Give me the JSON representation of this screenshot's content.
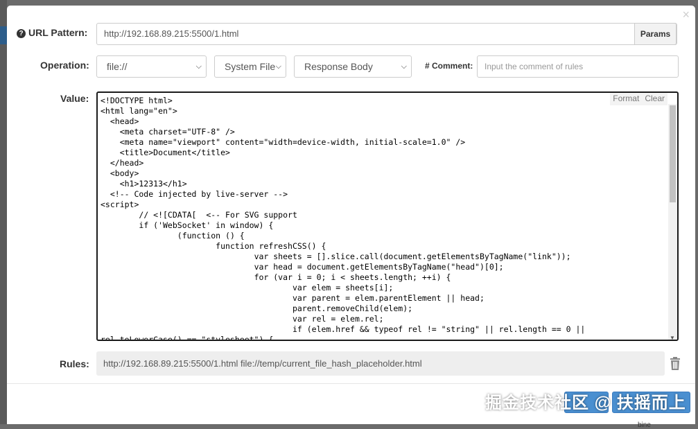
{
  "modal": {
    "close_label": "×",
    "url_pattern": {
      "label": "URL Pattern:",
      "value": "http://192.168.89.215:5500/1.html",
      "params_label": "Params"
    },
    "operation": {
      "label": "Operation:",
      "protocol": "file://",
      "source": "System File",
      "target": "Response Body"
    },
    "comment": {
      "label": "# Comment:",
      "placeholder": "Input the comment of rules"
    },
    "value": {
      "label": "Value:",
      "format_label": "Format",
      "clear_label": "Clear",
      "code": "<!DOCTYPE html>\n<html lang=\"en\">\n  <head>\n    <meta charset=\"UTF-8\" />\n    <meta name=\"viewport\" content=\"width=device-width, initial-scale=1.0\" />\n    <title>Document</title>\n  </head>\n  <body>\n    <h1>12313</h1>\n  <!-- Code injected by live-server -->\n<script>\n\t// <![CDATA[  <-- For SVG support\n\tif ('WebSocket' in window) {\n\t\t(function () {\n\t\t\tfunction refreshCSS() {\n\t\t\t\tvar sheets = [].slice.call(document.getElementsByTagName(\"link\"));\n\t\t\t\tvar head = document.getElementsByTagName(\"head\")[0];\n\t\t\t\tfor (var i = 0; i < sheets.length; ++i) {\n\t\t\t\t\tvar elem = sheets[i];\n\t\t\t\t\tvar parent = elem.parentElement || head;\n\t\t\t\t\tparent.removeChild(elem);\n\t\t\t\t\tvar rel = elem.rel;\n\t\t\t\t\tif (elem.href && typeof rel != \"string\" || rel.length == 0 ||\nrel.toLowerCase() == \"stylesheet\") {"
    },
    "rules": {
      "label": "Rules:",
      "value": "http://192.168.89.215:5500/1.html file://temp/current_file_hash_placeholder.html"
    },
    "footer": {
      "partial_button_text": "bine",
      "watermark": "掘金技术社区 @ 扶摇而上"
    }
  },
  "colors": {
    "accent": "#4a8fd0",
    "backdrop": "#6b6b6b",
    "editor_border": "#1a1a1a"
  }
}
